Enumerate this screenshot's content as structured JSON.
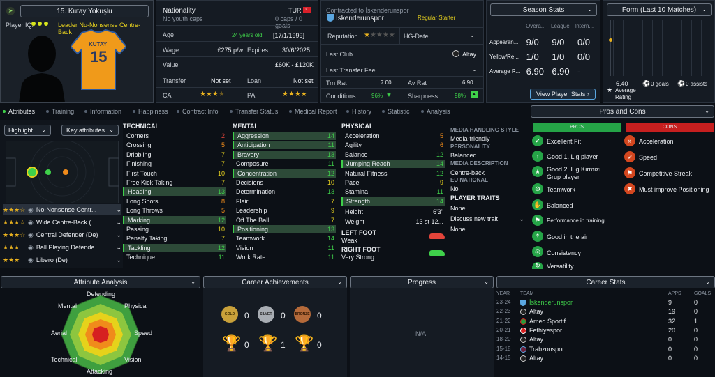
{
  "player": {
    "name": "15. Kutay Yokuşlu",
    "iq_label": "Player IQ:",
    "role": "Leader  No-Nonsense Centre-Back",
    "shirt_name": "KUTAY",
    "shirt_number": "15"
  },
  "nationality": {
    "label": "Nationality",
    "value": "TUR",
    "sub": "No youth caps",
    "caps": "0 caps / 0 goals"
  },
  "contract": {
    "club_line": "Contracted to İskenderunspor",
    "club": "İskenderunspor",
    "status": "Regular Starter"
  },
  "info": {
    "age_label": "Age",
    "age_value": "24 years old",
    "age_dob": "[17/1/1999]",
    "wage_label": "Wage",
    "wage_value": "£275 p/w",
    "expires_label": "Expires",
    "expires_value": "30/6/2025",
    "value_label": "Value",
    "value_value": "£60K - £120K",
    "transfer_label": "Transfer",
    "transfer_value": "Not set",
    "loan_label": "Loan",
    "loan_value": "Not set",
    "ca_label": "CA",
    "pa_label": "PA"
  },
  "club_info": {
    "reputation_label": "Reputation",
    "hg_label": "HG-Date",
    "hg_value": "-",
    "last_club_label": "Last Club",
    "last_club_value": "Altay",
    "last_fee_label": "Last Transfer Fee",
    "last_fee_value": "-",
    "trn_label": "Trn Rat",
    "trn_value": "7.00",
    "av_label": "Av Rat",
    "av_value": "6.90",
    "cond_label": "Conditions",
    "cond_value": "96%",
    "sharp_label": "Sharpness",
    "sharp_value": "98%"
  },
  "season": {
    "dropdown": "Season Stats",
    "cols": [
      "Overa...",
      "League",
      "Intern..."
    ],
    "rows": [
      {
        "label": "Appearan...",
        "v": [
          "9/0",
          "9/0",
          "0/0"
        ]
      },
      {
        "label": "Yellow/Re...",
        "v": [
          "1/0",
          "1/0",
          "0/0"
        ]
      },
      {
        "label": "Average R...",
        "v": [
          "6.90",
          "6.90",
          "-"
        ]
      }
    ],
    "button": "View Player Stats"
  },
  "form": {
    "dropdown": "Form (Last 10 Matches)",
    "rating": "6.40",
    "rating_label": "Average Rating",
    "goals": "0 goals",
    "assists": "0 assists"
  },
  "tabs": [
    "Attributes",
    "Training",
    "Information",
    "Happiness",
    "Contract Info",
    "Transfer Status",
    "Medical Report",
    "History",
    "Statistic",
    "Analysis"
  ],
  "left": {
    "highlight": "Highlight",
    "key_attr": "Key attributes",
    "roles": [
      {
        "stars": "★★★☆",
        "name": "No-Nonsense Centr..."
      },
      {
        "stars": "★★★☆",
        "name": "Wide Centre-Back (..."
      },
      {
        "stars": "★★★☆",
        "name": "Central Defender (De)"
      },
      {
        "stars": "★★★",
        "name": "Ball Playing Defende..."
      },
      {
        "stars": "★★★",
        "name": "Libero (De)"
      }
    ]
  },
  "technical": {
    "title": "TECHNICAL",
    "items": [
      {
        "n": "Corners",
        "v": "2",
        "c": "red",
        "h": false
      },
      {
        "n": "Crossing",
        "v": "5",
        "c": "orange",
        "h": false
      },
      {
        "n": "Dribbling",
        "v": "7",
        "c": "yellow",
        "h": false
      },
      {
        "n": "Finishing",
        "v": "7",
        "c": "yellow",
        "h": false
      },
      {
        "n": "First Touch",
        "v": "10",
        "c": "yellow",
        "h": false
      },
      {
        "n": "Free Kick Taking",
        "v": "7",
        "c": "yellow",
        "h": false
      },
      {
        "n": "Heading",
        "v": "13",
        "c": "green",
        "h": true
      },
      {
        "n": "Long Shots",
        "v": "8",
        "c": "orange",
        "h": false
      },
      {
        "n": "Long Throws",
        "v": "5",
        "c": "orange",
        "h": false
      },
      {
        "n": "Marking",
        "v": "12",
        "c": "green",
        "h": true
      },
      {
        "n": "Passing",
        "v": "10",
        "c": "yellow",
        "h": false
      },
      {
        "n": "Penalty Taking",
        "v": "7",
        "c": "yellow",
        "h": false
      },
      {
        "n": "Tackling",
        "v": "12",
        "c": "green",
        "h": true
      },
      {
        "n": "Technique",
        "v": "11",
        "c": "green",
        "h": false
      }
    ]
  },
  "mental": {
    "title": "MENTAL",
    "items": [
      {
        "n": "Aggression",
        "v": "14",
        "c": "green",
        "h": true
      },
      {
        "n": "Anticipation",
        "v": "11",
        "c": "green",
        "h": true
      },
      {
        "n": "Bravery",
        "v": "13",
        "c": "green",
        "h": true
      },
      {
        "n": "Composure",
        "v": "11",
        "c": "green",
        "h": false
      },
      {
        "n": "Concentration",
        "v": "12",
        "c": "green",
        "h": true
      },
      {
        "n": "Decisions",
        "v": "10",
        "c": "yellow",
        "h": false
      },
      {
        "n": "Determination",
        "v": "13",
        "c": "green",
        "h": false
      },
      {
        "n": "Flair",
        "v": "7",
        "c": "yellow",
        "h": false
      },
      {
        "n": "Leadership",
        "v": "9",
        "c": "yellow",
        "h": false
      },
      {
        "n": "Off The Ball",
        "v": "7",
        "c": "yellow",
        "h": false
      },
      {
        "n": "Positioning",
        "v": "13",
        "c": "green",
        "h": true
      },
      {
        "n": "Teamwork",
        "v": "14",
        "c": "green",
        "h": false
      },
      {
        "n": "Vision",
        "v": "11",
        "c": "green",
        "h": false
      },
      {
        "n": "Work Rate",
        "v": "11",
        "c": "green",
        "h": false
      }
    ]
  },
  "physical": {
    "title": "PHYSICAL",
    "items": [
      {
        "n": "Acceleration",
        "v": "5",
        "c": "orange",
        "h": false
      },
      {
        "n": "Agility",
        "v": "6",
        "c": "orange",
        "h": false
      },
      {
        "n": "Balance",
        "v": "12",
        "c": "green",
        "h": false
      },
      {
        "n": "Jumping Reach",
        "v": "14",
        "c": "green",
        "h": true
      },
      {
        "n": "Natural Fitness",
        "v": "12",
        "c": "green",
        "h": false
      },
      {
        "n": "Pace",
        "v": "9",
        "c": "yellow",
        "h": false
      },
      {
        "n": "Stamina",
        "v": "11",
        "c": "green",
        "h": false
      },
      {
        "n": "Strength",
        "v": "14",
        "c": "green",
        "h": true
      }
    ],
    "height_label": "Height",
    "height_value": "6'3\"",
    "weight_label": "Weight",
    "weight_value": "13 st 12...",
    "left_foot_label": "LEFT FOOT",
    "left_foot_value": "Weak",
    "right_foot_label": "RIGHT FOOT",
    "right_foot_value": "Very Strong"
  },
  "media": {
    "style_label": "MEDIA HANDLING STYLE",
    "style_value": "Media-friendly",
    "personality_label": "PERSONALITY",
    "personality_value": "Balanced",
    "desc_label": "MEDIA DESCRIPTION",
    "desc_value": "Centre-back",
    "eu_label": "EU NATIONAL",
    "eu_value": "No",
    "traits_label": "PLAYER TRAITS",
    "traits_value": "None",
    "discuss": "Discuss new trait",
    "discuss_value": "None"
  },
  "pros_cons": {
    "dropdown": "Pros and Cons",
    "pros_label": "PROS",
    "cons_label": "CONS",
    "pros": [
      "Excellent Fit",
      "Good 1. Lig player",
      "Good 2. Lig Kırmızı Grup player",
      "Teamwork",
      "Balanced",
      "Performance in training",
      "Good in the air",
      "Consistency",
      "Versatility"
    ],
    "cons": [
      "Acceleration",
      "Speed",
      "Competitive Streak",
      "Must improve Positioning"
    ]
  },
  "bottom": {
    "analysis": "Attribute Analysis",
    "achievements": "Career Achievements",
    "progress": "Progress",
    "progress_value": "N/A",
    "career": "Career Stats"
  },
  "radar": {
    "labels": [
      "Defending",
      "Physical",
      "Speed",
      "Vision",
      "Attacking",
      "Technical",
      "Aerial",
      "Mental"
    ]
  },
  "achievements": {
    "medals": [
      {
        "label": "GOLD",
        "count": "0"
      },
      {
        "label": "SILVER",
        "count": "0"
      },
      {
        "label": "BRONZE",
        "count": "0"
      }
    ],
    "trophies": [
      "0",
      "1",
      "0"
    ]
  },
  "career": {
    "cols": [
      "YEAR",
      "TEAM",
      "APPS",
      "GOALS"
    ],
    "rows": [
      {
        "y": "23-24",
        "t": "İskenderunspor",
        "a": "9",
        "g": "0",
        "hl": true
      },
      {
        "y": "22-23",
        "t": "Altay",
        "a": "19",
        "g": "0",
        "hl": false
      },
      {
        "y": "21-22",
        "t": "Amed Sportif",
        "a": "32",
        "g": "1",
        "hl": false
      },
      {
        "y": "20-21",
        "t": "Fethiyespor",
        "a": "20",
        "g": "0",
        "hl": false
      },
      {
        "y": "18-20",
        "t": "Altay",
        "a": "0",
        "g": "0",
        "hl": false
      },
      {
        "y": "15-18",
        "t": "Trabzonspor",
        "a": "0",
        "g": "0",
        "hl": false
      },
      {
        "y": "14-15",
        "t": "Altay",
        "a": "0",
        "g": "0",
        "hl": false
      }
    ]
  }
}
